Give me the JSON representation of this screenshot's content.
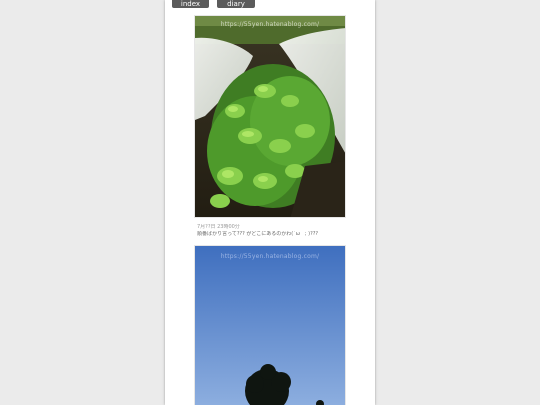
{
  "nav": {
    "index_label": "index",
    "diary_label": "diary index"
  },
  "post": {
    "photo1": {
      "description": "Green leafy seedlings growing under a white protective net",
      "watermark": "https://55yen.hatenablog.com/"
    },
    "date": "7月??日 23時00分",
    "caption": "順番ばかり言って??? がどこにあるのかわ(´ω｀; )???",
    "photo2": {
      "description": "Blue sky with silhouette of a tree top",
      "watermark": "https://55yen.hatenablog.com/"
    }
  },
  "colors": {
    "page_bg": "#ebebeb",
    "content_bg": "#ffffff",
    "nav_bg": "#5b5b5b"
  }
}
